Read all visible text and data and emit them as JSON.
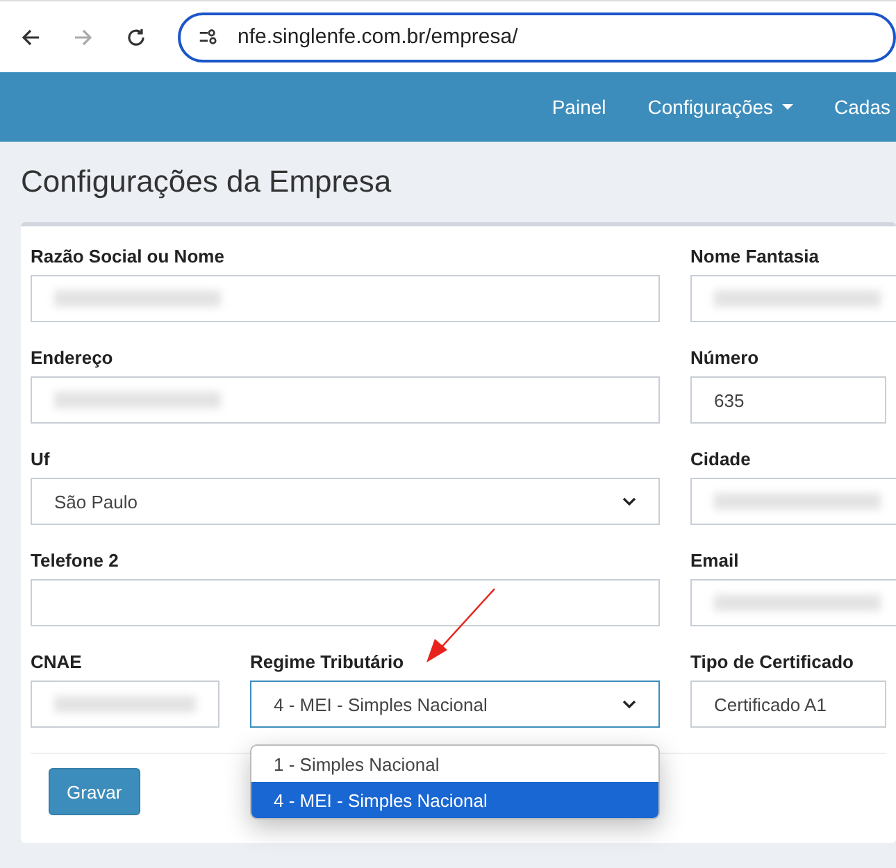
{
  "browser": {
    "url": "nfe.singlenfe.com.br/empresa/"
  },
  "nav": {
    "items": [
      {
        "label": "Painel",
        "dropdown": false
      },
      {
        "label": "Configurações",
        "dropdown": true
      },
      {
        "label": "Cadas",
        "dropdown": false
      }
    ]
  },
  "page_title": "Configurações da Empresa",
  "rows": [
    {
      "fields": [
        {
          "label": "Razão Social ou Nome",
          "kind": "input",
          "blurred": true
        },
        {
          "label": "Nome Fantasia",
          "kind": "input",
          "blurred": true
        }
      ]
    },
    {
      "fields": [
        {
          "label": "Endereço",
          "kind": "input",
          "blurred": true
        },
        {
          "label": "Número",
          "kind": "input",
          "blurred": false,
          "value": "635"
        }
      ]
    },
    {
      "fields": [
        {
          "label": "Uf",
          "kind": "select",
          "blurred": false,
          "value": "São Paulo"
        },
        {
          "label": "Cidade",
          "kind": "input",
          "blurred": true
        }
      ]
    },
    {
      "fields": [
        {
          "label": "Telefone 2",
          "kind": "input",
          "blurred": false
        },
        {
          "label": "Email",
          "kind": "input",
          "blurred": true
        }
      ]
    },
    {
      "fields": [
        {
          "label": "CNAE",
          "kind": "input",
          "blurred": true
        },
        {
          "label": "Regime Tributário",
          "kind": "select",
          "blurred": false,
          "value": "4 - MEI - Simples Nacional",
          "open": true,
          "options": [
            {
              "label": "1 - Simples Nacional",
              "selected": false
            },
            {
              "label": "4 - MEI - Simples Nacional",
              "selected": true
            }
          ]
        },
        {
          "label": "Tipo de Certificado",
          "kind": "input",
          "blurred": false,
          "value": "Certificado A1"
        }
      ]
    }
  ],
  "buttons": [
    {
      "label": "Gravar"
    }
  ]
}
